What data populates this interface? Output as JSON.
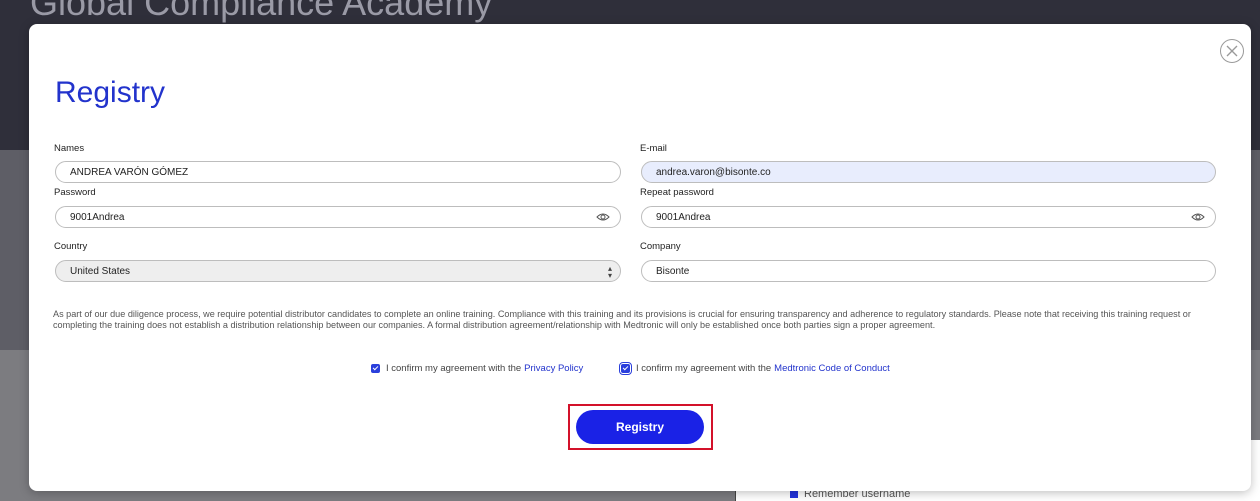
{
  "background": {
    "title": "Global Compliance Academy",
    "remember_label": "Remember username"
  },
  "modal": {
    "title": "Registry",
    "fields": {
      "names": {
        "label": "Names",
        "value": "ANDREA VARÓN GÓMEZ"
      },
      "email": {
        "label": "E-mail",
        "value": "andrea.varon@bisonte.co"
      },
      "password": {
        "label": "Password",
        "value": "9001Andrea"
      },
      "repeat_password": {
        "label": "Repeat password",
        "value": "9001Andrea"
      },
      "country": {
        "label": "Country",
        "value": "United States"
      },
      "company": {
        "label": "Company",
        "value": "Bisonte"
      }
    },
    "disclaimer": "As part of our due diligence process, we require potential distributor candidates to complete an online training. Compliance with this training and its provisions is crucial for ensuring transparency and adherence to regulatory standards. Please note that receiving this training request or completing the training does not establish a distribution relationship between our companies. A formal distribution agreement/relationship with Medtronic will only be established once both parties sign a proper agreement.",
    "consents": [
      {
        "text": "I confirm my agreement with the",
        "link": "Privacy Policy",
        "checked": true
      },
      {
        "text": "I confirm my agreement with the",
        "link": "Medtronic Code of Conduct",
        "checked": true
      }
    ],
    "submit_label": "Registry"
  },
  "colors": {
    "accent": "#1a22e6",
    "title": "#2233cc",
    "highlight": "#d3112a"
  },
  "icons": {
    "close": "close-circle-icon",
    "eye": "eye-icon",
    "select": "select-arrows-icon",
    "checkbox": "checkbox-checked-icon"
  }
}
